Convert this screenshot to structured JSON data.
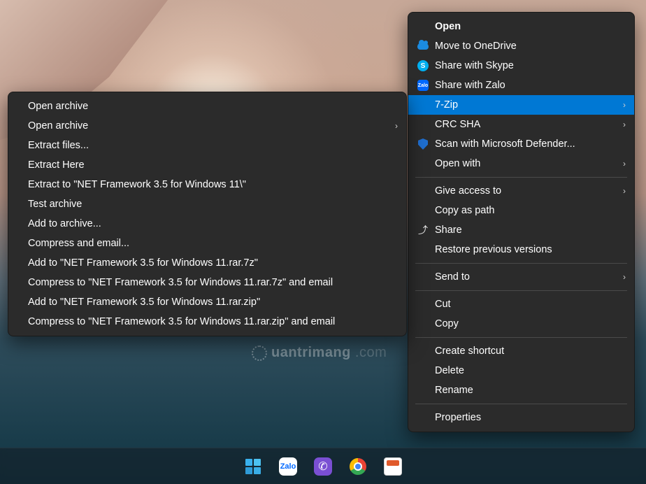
{
  "watermark": "uantrimang",
  "contextMenu": {
    "items": [
      {
        "label": "Open",
        "bold": true,
        "icon": null,
        "submenu": false
      },
      {
        "label": "Move to OneDrive",
        "icon": "onedrive",
        "submenu": false
      },
      {
        "label": "Share with Skype",
        "icon": "skype",
        "submenu": false
      },
      {
        "label": "Share with Zalo",
        "icon": "zalo",
        "submenu": false
      },
      {
        "label": "7-Zip",
        "icon": null,
        "submenu": true,
        "highlight": true
      },
      {
        "label": "CRC SHA",
        "icon": null,
        "submenu": true
      },
      {
        "label": "Scan with Microsoft Defender...",
        "icon": "shield",
        "submenu": false
      },
      {
        "label": "Open with",
        "icon": null,
        "submenu": true
      },
      {
        "sep": true
      },
      {
        "label": "Give access to",
        "icon": null,
        "submenu": true
      },
      {
        "label": "Copy as path",
        "icon": null,
        "submenu": false
      },
      {
        "label": "Share",
        "icon": "share",
        "submenu": false
      },
      {
        "label": "Restore previous versions",
        "icon": null,
        "submenu": false
      },
      {
        "sep": true
      },
      {
        "label": "Send to",
        "icon": null,
        "submenu": true
      },
      {
        "sep": true
      },
      {
        "label": "Cut",
        "icon": null,
        "submenu": false
      },
      {
        "label": "Copy",
        "icon": null,
        "submenu": false
      },
      {
        "sep": true
      },
      {
        "label": "Create shortcut",
        "icon": null,
        "submenu": false
      },
      {
        "label": "Delete",
        "icon": null,
        "submenu": false
      },
      {
        "label": "Rename",
        "icon": null,
        "submenu": false
      },
      {
        "sep": true
      },
      {
        "label": "Properties",
        "icon": null,
        "submenu": false
      }
    ]
  },
  "submenu7zip": {
    "items": [
      {
        "label": "Open archive",
        "submenu": false
      },
      {
        "label": "Open archive",
        "submenu": true
      },
      {
        "label": "Extract files...",
        "submenu": false
      },
      {
        "label": "Extract Here",
        "submenu": false
      },
      {
        "label": "Extract to \"NET Framework 3.5 for Windows 11\\\"",
        "submenu": false
      },
      {
        "label": "Test archive",
        "submenu": false
      },
      {
        "label": "Add to archive...",
        "submenu": false
      },
      {
        "label": "Compress and email...",
        "submenu": false
      },
      {
        "label": "Add to \"NET Framework 3.5 for Windows 11.rar.7z\"",
        "submenu": false
      },
      {
        "label": "Compress to \"NET Framework 3.5 for Windows 11.rar.7z\" and email",
        "submenu": false
      },
      {
        "label": "Add to \"NET Framework 3.5 for Windows 11.rar.zip\"",
        "submenu": false
      },
      {
        "label": "Compress to \"NET Framework 3.5 for Windows 11.rar.zip\" and email",
        "submenu": false
      }
    ]
  },
  "taskbar": {
    "items": [
      "start",
      "zalo",
      "viber",
      "chrome",
      "snip"
    ]
  },
  "iconGlyphs": {
    "skype": "S",
    "zalo": "Zalo",
    "share": "⇪"
  }
}
